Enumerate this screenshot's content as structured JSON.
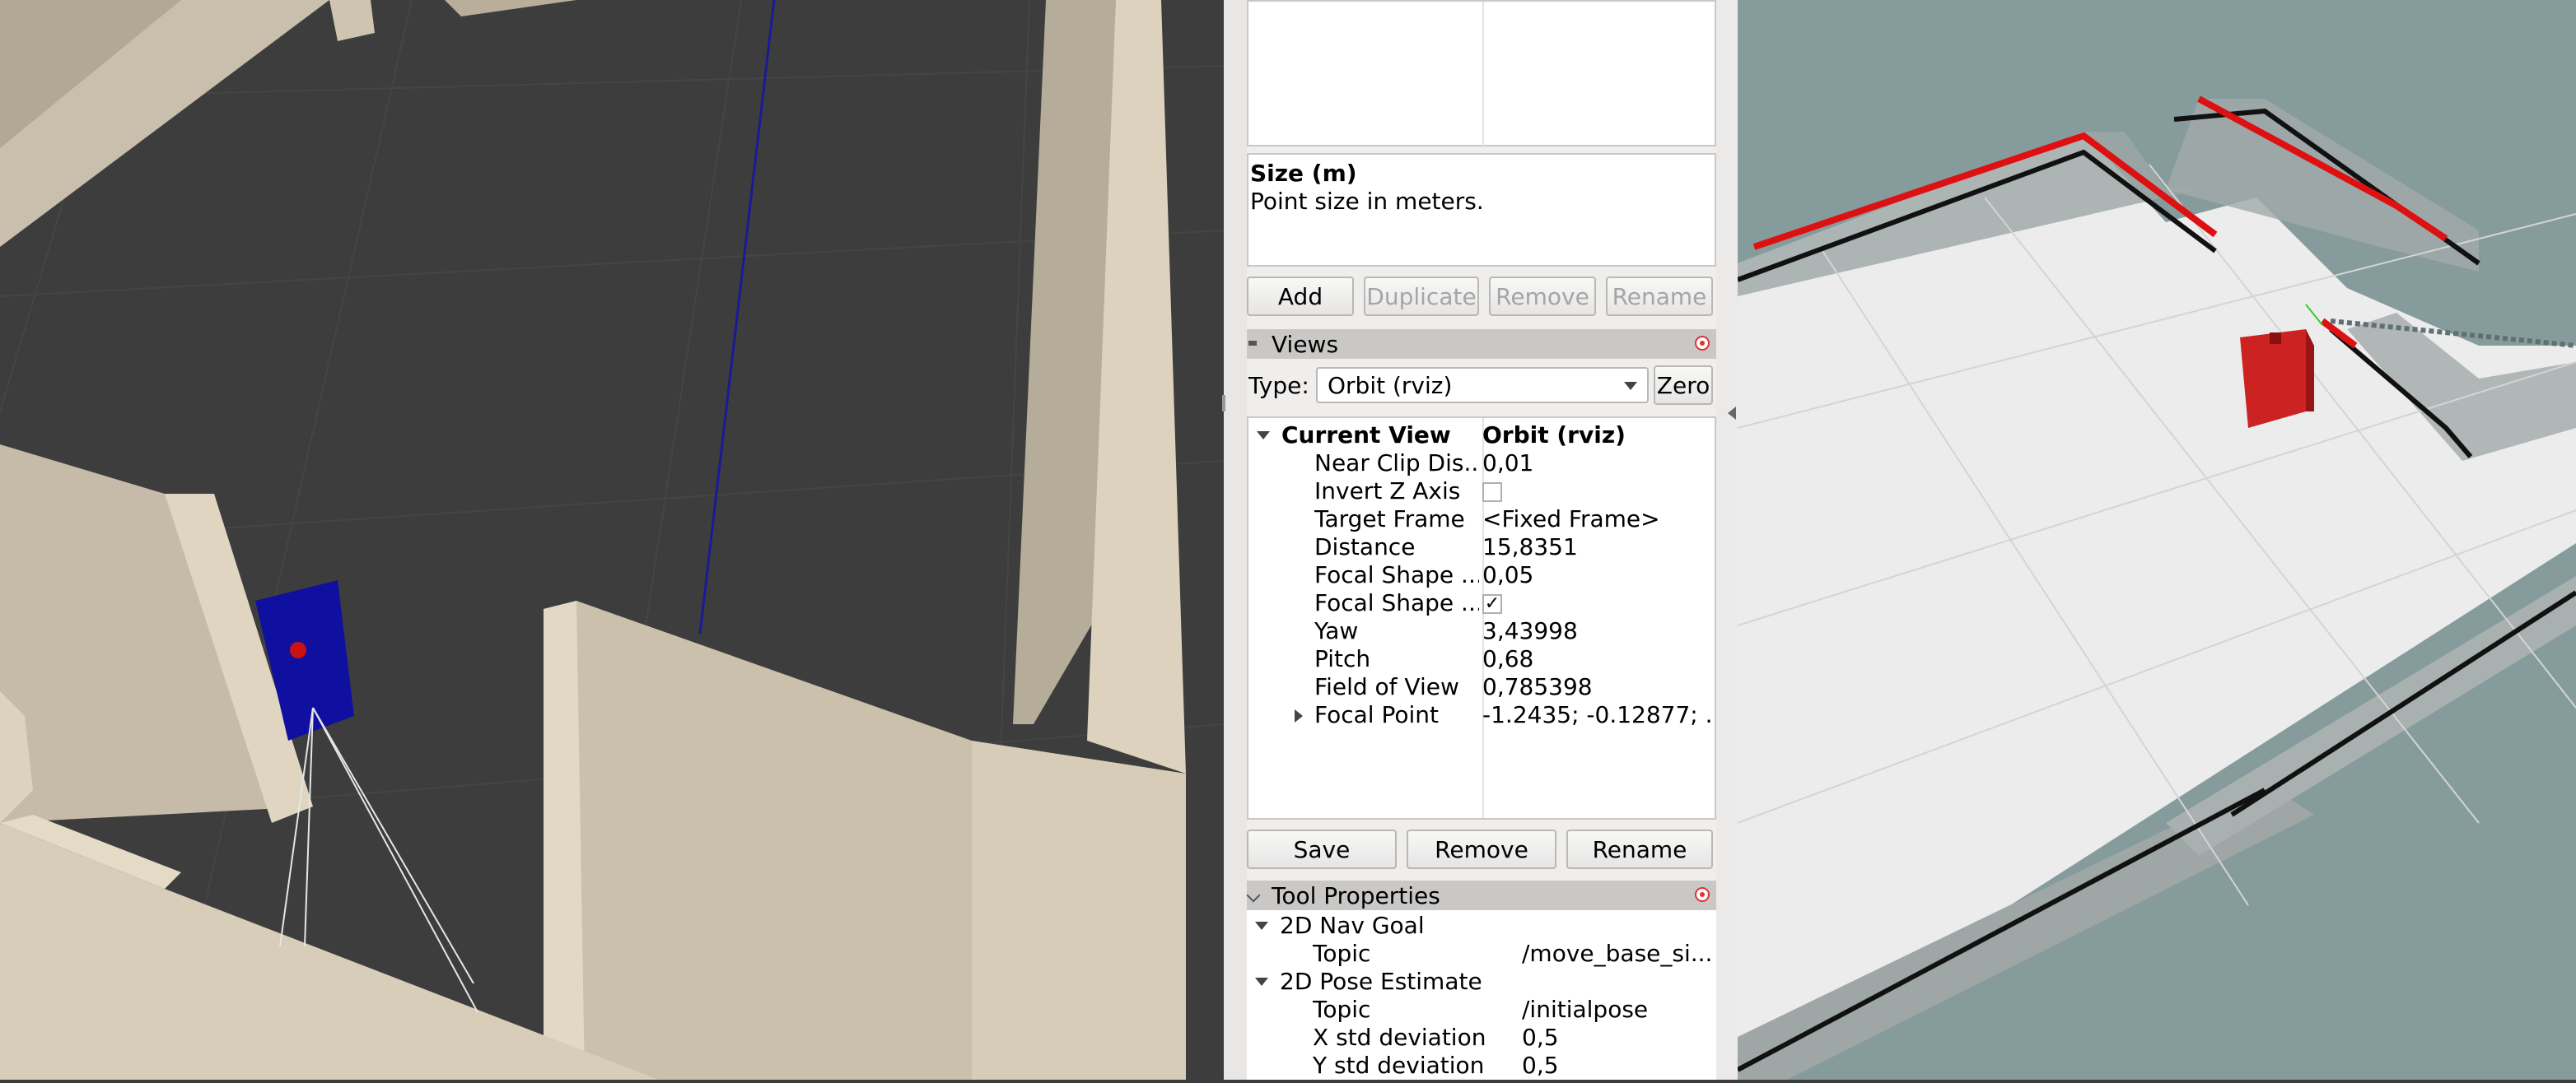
{
  "description_box": {
    "title": "Size (m)",
    "text": "Point size in meters."
  },
  "displays_buttons": {
    "add": "Add",
    "duplicate": "Duplicate",
    "remove": "Remove",
    "rename": "Rename"
  },
  "views": {
    "header": "Views",
    "type_label": "Type:",
    "type_value": "Orbit (rviz)",
    "zero_label": "Zero",
    "current_view": {
      "name": "Current View",
      "value": "Orbit (rviz)"
    },
    "properties": [
      {
        "name": "Near Clip Dis...",
        "value": "0,01"
      },
      {
        "name": "Invert Z Axis",
        "value": ""
      },
      {
        "name": "Target Frame",
        "value": "<Fixed Frame>"
      },
      {
        "name": "Distance",
        "value": "15,8351"
      },
      {
        "name": "Focal Shape ...",
        "value": "0,05"
      },
      {
        "name": "Focal Shape ...",
        "value": "✓"
      },
      {
        "name": "Yaw",
        "value": "3,43998"
      },
      {
        "name": "Pitch",
        "value": "0,68"
      },
      {
        "name": "Field of View",
        "value": "0,785398"
      },
      {
        "name": "Focal Point",
        "value": "-1.2435; -0.12877; ..."
      }
    ],
    "buttons": {
      "save": "Save",
      "remove": "Remove",
      "rename": "Rename"
    }
  },
  "tool_properties": {
    "header": "Tool Properties",
    "nav_goal": {
      "name": "2D Nav Goal",
      "topic_label": "Topic",
      "topic_value": "/move_base_si..."
    },
    "pose_estimate": {
      "name": "2D Pose Estimate",
      "topic_label": "Topic",
      "topic_value": "/initialpose",
      "x_label": "X std deviation",
      "x_value": "0,5",
      "y_label": "Y std deviation",
      "y_value": "0,5"
    }
  },
  "colors": {
    "gazebo_floor": "#3c3c3c",
    "wall": "#d9cdb8",
    "robot_gazebo": "#1010a0",
    "robot_rviz": "#cc2222",
    "laser": "#e01010",
    "map_bg": "#869c9c"
  }
}
